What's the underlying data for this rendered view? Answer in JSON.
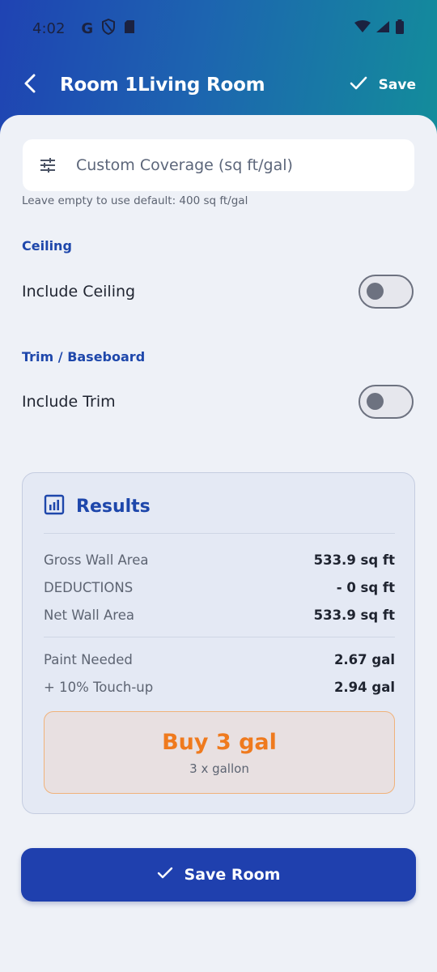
{
  "status_bar": {
    "time": "4:02",
    "google_glyph": "G"
  },
  "appbar": {
    "title": "Room 1Living Room",
    "save_label": "Save"
  },
  "form": {
    "coverage_placeholder": "Custom Coverage (sq ft/gal)",
    "coverage_value": "",
    "coverage_helper": "Leave empty to use default: 400 sq ft/gal",
    "ceiling_section": "Ceiling",
    "ceiling_toggle_label": "Include Ceiling",
    "ceiling_toggle_on": false,
    "trim_section": "Trim / Baseboard",
    "trim_toggle_label": "Include Trim",
    "trim_toggle_on": false
  },
  "results": {
    "title": "Results",
    "rows": [
      {
        "label": "Gross Wall Area",
        "value": "533.9 sq ft"
      },
      {
        "label": "DEDUCTIONS",
        "value": "- 0 sq ft"
      },
      {
        "label": "Net Wall Area",
        "value": "533.9 sq ft"
      },
      {
        "label": "Paint Needed",
        "value": "2.67 gal"
      },
      {
        "label": "+ 10% Touch-up",
        "value": "2.94 gal"
      }
    ],
    "buy_main": "Buy 3 gal",
    "buy_sub": "3 x gallon"
  },
  "save_room_label": "Save Room",
  "colors": {
    "primary": "#1f40ae",
    "accent_orange": "#ef7a1e",
    "section_blue": "#1e47ab",
    "header_gradient_start": "#1f43b3",
    "header_gradient_end": "#138d9b"
  }
}
